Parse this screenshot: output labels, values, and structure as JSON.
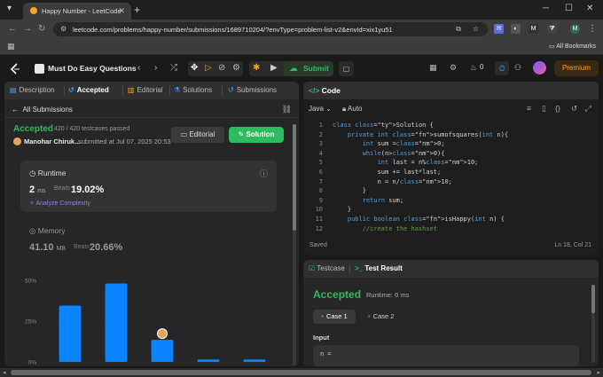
{
  "browser": {
    "tab_title": "Happy Number - LeetCode",
    "url": "leetcode.com/problems/happy-number/submissions/1689710204/?envType=problem-list-v2&envId=xix1yu51",
    "all_bookmarks": "All Bookmarks",
    "profile_initial": "M"
  },
  "lc_nav": {
    "list_name": "Must Do Easy Questions",
    "submit_label": "Submit",
    "streak_count": "0",
    "premium_label": "Premium"
  },
  "left_tabs": [
    "Description",
    "Accepted",
    "Editorial",
    "Solutions",
    "Submissions"
  ],
  "submission": {
    "back_label": "All Submissions",
    "status": "Accepted",
    "testcases": "420 / 420 testcases passed",
    "user": "Manohar Chiruk...",
    "submitted_at": "submitted at Jul 07, 2025 20:53",
    "editorial_btn": "Editorial",
    "solution_btn": "Solution"
  },
  "runtime": {
    "label": "Runtime",
    "value": "2",
    "unit": "ms",
    "beats_label": "Beats",
    "beats_pct": "19.02%",
    "analyze": "Analyze Complexity"
  },
  "memory": {
    "label": "Memory",
    "value": "41.10",
    "unit": "MB",
    "beats_label": "Beats",
    "beats_pct": "20.66%"
  },
  "chart_data": {
    "type": "bar",
    "title": "",
    "xlabel": "",
    "ylabel": "",
    "y_ticks": [
      "50%",
      "25%",
      "0%"
    ],
    "ylim": [
      0,
      50
    ],
    "values": [
      34.5,
      48,
      13.5,
      1.5,
      1.5
    ],
    "user_marker_index": 2,
    "bar_color": "#0a84ff",
    "grid": true
  },
  "code_panel": {
    "title": "Code",
    "language": "Java",
    "mode": "Auto",
    "lines": [
      {
        "n": "1",
        "t": "class Solution {"
      },
      {
        "n": "2",
        "t": "    private int sumofsquares(int n){"
      },
      {
        "n": "3",
        "t": "        int sum =0;"
      },
      {
        "n": "4",
        "t": "        while(n>0){"
      },
      {
        "n": "5",
        "t": "            int last = n%10;"
      },
      {
        "n": "6",
        "t": "            sum += last*last;"
      },
      {
        "n": "7",
        "t": "            n = n/10;"
      },
      {
        "n": "8",
        "t": "        }"
      },
      {
        "n": "9",
        "t": "        return sum;"
      },
      {
        "n": "10",
        "t": "    }"
      },
      {
        "n": "11",
        "t": "    public boolean isHappy(int n) {"
      },
      {
        "n": "12",
        "t": "        //create the hashset"
      }
    ],
    "saved": "Saved",
    "cursor": "Ln 18, Col 21"
  },
  "result_panel": {
    "tab_testcase": "Testcase",
    "tab_result": "Test Result",
    "status": "Accepted",
    "runtime": "Runtime: 0 ms",
    "case1": "Case 1",
    "case2": "Case 2",
    "input_label": "Input",
    "input_value": "n ="
  },
  "colors": {
    "accent_green": "#2cbb5d",
    "premium_orange": "#ffa116",
    "bar_blue": "#0a84ff"
  }
}
